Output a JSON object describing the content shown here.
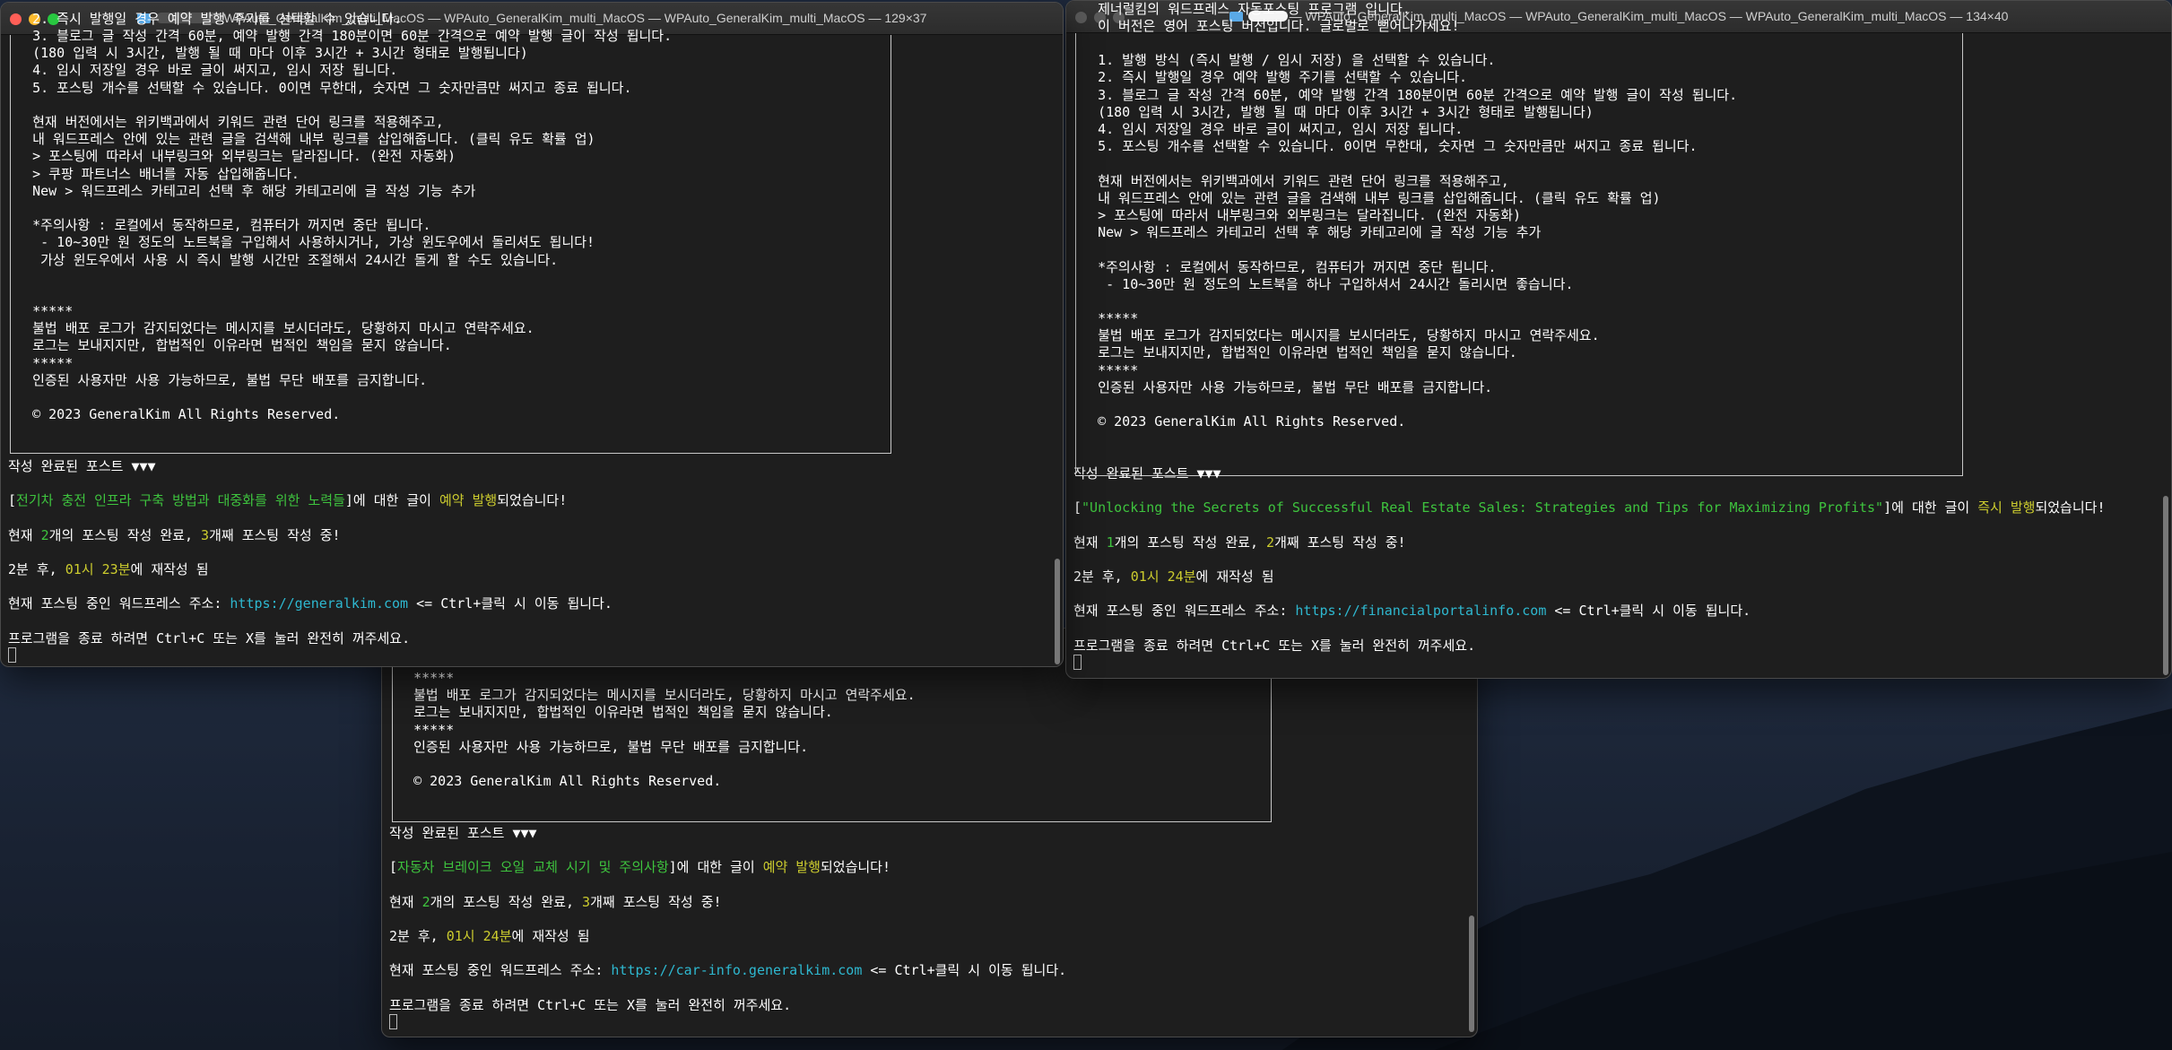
{
  "desktop": {
    "wallpaper": "night-mountain-wallpaper"
  },
  "windows": [
    {
      "id": "terminal-1",
      "title": "WPAuto_GeneralKim_multi_MacOS — WPAuto_GeneralKim_multi_MacOS — WPAuto_GeneralKim_multi_MacOS — 129×37",
      "lines": [
        "   2. 즉시 발행일 경우 예약 발행 주기를 선택할 수 있습니다.",
        "   3. 블로그 글 작성 간격 60분, 예약 발행 간격 180분이면 60분 간격으로 예약 발행 글이 작성 됩니다.",
        "   (180 입력 시 3시간, 발행 될 때 마다 이후 3시간 + 3시간 형태로 발행됩니다)",
        "   4. 임시 저장일 경우 바로 글이 써지고, 임시 저장 됩니다.",
        "   5. 포스팅 개수를 선택할 수 있습니다. 0이면 무한대, 숫자면 그 숫자만큼만 써지고 종료 됩니다.",
        "",
        "   현재 버전에서는 위키백과에서 키워드 관련 단어 링크를 적용해주고,",
        "   내 워드프레스 안에 있는 관련 글을 검색해 내부 링크를 삽입해줍니다. (클릭 유도 확률 업)",
        "   > 포스팅에 따라서 내부링크와 외부링크는 달라집니다. (완전 자동화)",
        "   > 쿠팡 파트너스 배너를 자동 삽입해줍니다.",
        "   New > 워드프레스 카테고리 선택 후 해당 카테고리에 글 작성 기능 추가",
        "",
        "   *주의사항 : 로컬에서 동작하므로, 컴퓨터가 꺼지면 중단 됩니다.",
        "    - 10~30만 원 정도의 노트북을 구입해서 사용하시거나, 가상 윈도우에서 돌리셔도 됩니다!",
        "    가상 윈도우에서 사용 시 즉시 발행 시간만 조절해서 24시간 돌게 할 수도 있습니다.",
        "",
        "",
        "   *****",
        "   불법 배포 로그가 감지되었다는 메시지를 보시더라도, 당황하지 마시고 연락주세요.",
        "   로그는 보내지지만, 합법적인 이유라면 법적인 책임을 묻지 않습니다.",
        "   *****",
        "   인증된 사용자만 사용 가능하므로, 불법 무단 배포를 금지합니다.",
        "",
        "   © 2023 GeneralKim All Rights Reserved.",
        "",
        "",
        "작성 완료된 포스트 ▼▼▼",
        "",
        "[전기차 충전 인프라 구축 방법과 대중화를 위한 노력들]에 대한 글이 예약 발행되었습니다!",
        "",
        "현재 2개의 포스팅 작성 완료, 3개째 포스팅 작성 중!",
        "",
        "2분 후, 01시 23분에 재작성 됨",
        "",
        "현재 포스팅 중인 워드프레스 주소: https://generalkim.com <= Ctrl+클릭 시 이동 됩니다.",
        "",
        "프로그램을 종료 하려면 Ctrl+C 또는 X를 눌러 완전히 꺼주세요."
      ]
    },
    {
      "id": "terminal-2",
      "title": "— WPAuto_GeneralKim_multi_MacOS — WPAuto_GeneralKim_multi_MacOS — WPAuto_GeneralKim_multi_MacOS — 134×40",
      "lines": [
        "",
        "   제너럴킴의 워드프레스 자동포스팅 프로그램 입니다.",
        "   이 버전은 영어 포스팅 버전입니다. 글로벌로 뻗어나가세요!",
        "",
        "   1. 발행 방식 (즉시 발행 / 임시 저장) 을 선택할 수 있습니다.",
        "   2. 즉시 발행일 경우 예약 발행 주기를 선택할 수 있습니다.",
        "   3. 블로그 글 작성 간격 60분, 예약 발행 간격 180분이면 60분 간격으로 예약 발행 글이 작성 됩니다.",
        "   (180 입력 시 3시간, 발행 될 때 마다 이후 3시간 + 3시간 형태로 발행됩니다)",
        "   4. 임시 저장일 경우 바로 글이 써지고, 임시 저장 됩니다.",
        "   5. 포스팅 개수를 선택할 수 있습니다. 0이면 무한대, 숫자면 그 숫자만큼만 써지고 종료 됩니다.",
        "",
        "   현재 버전에서는 위키백과에서 키워드 관련 단어 링크를 적용해주고,",
        "   내 워드프레스 안에 있는 관련 글을 검색해 내부 링크를 삽입해줍니다. (클릭 유도 확률 업)",
        "   > 포스팅에 따라서 내부링크와 외부링크는 달라집니다. (완전 자동화)",
        "   New > 워드프레스 카테고리 선택 후 해당 카테고리에 글 작성 기능 추가",
        "",
        "   *주의사항 : 로컬에서 동작하므로, 컴퓨터가 꺼지면 중단 됩니다.",
        "    - 10~30만 원 정도의 노트북을 하나 구입하셔서 24시간 돌리시면 좋습니다.",
        "",
        "   *****",
        "   불법 배포 로그가 감지되었다는 메시지를 보시더라도, 당황하지 마시고 연락주세요.",
        "   로그는 보내지지만, 합법적인 이유라면 법적인 책임을 묻지 않습니다.",
        "   *****",
        "   인증된 사용자만 사용 가능하므로, 불법 무단 배포를 금지합니다.",
        "",
        "   © 2023 GeneralKim All Rights Reserved.",
        "",
        "",
        "작성 완료된 포스트 ▼▼▼",
        "",
        "[\"Unlocking the Secrets of Successful Real Estate Sales: Strategies and Tips for Maximizing Profits\"]에 대한 글이 즉시 발행되었습니다!",
        "",
        "현재 1개의 포스팅 작성 완료, 2개째 포스팅 작성 중!",
        "",
        "2분 후, 01시 24분에 재작성 됨",
        "",
        "현재 포스팅 중인 워드프레스 주소: https://financialportalinfo.com <= Ctrl+클릭 시 이동 됩니다.",
        "",
        "프로그램을 종료 하려면 Ctrl+C 또는 X를 눌러 완전히 꺼주세요."
      ]
    },
    {
      "id": "terminal-3",
      "title": "",
      "lines": [
        "",
        "   *****",
        "   불법 배포 로그가 감지되었다는 메시지를 보시더라도, 당황하지 마시고 연락주세요.",
        "   로그는 보내지지만, 합법적인 이유라면 법적인 책임을 묻지 않습니다.",
        "   *****",
        "   인증된 사용자만 사용 가능하므로, 불법 무단 배포를 금지합니다.",
        "",
        "   © 2023 GeneralKim All Rights Reserved.",
        "",
        "",
        "작성 완료된 포스트 ▼▼▼",
        "",
        "[자동차 브레이크 오일 교체 시기 및 주의사항]에 대한 글이 예약 발행되었습니다!",
        "",
        "현재 2개의 포스팅 작성 완료, 3개째 포스팅 작성 중!",
        "",
        "2분 후, 01시 24분에 재작성 됨",
        "",
        "현재 포스팅 중인 워드프레스 주소: https://car-info.generalkim.com <= Ctrl+클릭 시 이동 됩니다.",
        "",
        "프로그램을 종료 하려면 Ctrl+C 또는 X를 눌러 완전히 꺼주세요."
      ]
    }
  ],
  "highlights": {
    "green": [
      "전기차 충전 인프라 구축 방법과 대중화를 위한 노력들",
      "\"Unlocking the Secrets of Successful Real Estate Sales: Strategies and Tips for Maximizing Profits\"",
      "자동차 브레이크 오일 교체 시기 및 주의사항",
      "2",
      "1"
    ],
    "yellow": [
      "예약 발행",
      "즉시 발행",
      "01시 23분",
      "01시 24분",
      "3",
      "2"
    ],
    "link": [
      "https://generalkim.com",
      "https://financialportalinfo.com",
      "https://car-info.generalkim.com"
    ]
  },
  "colors": {
    "terminal_bg": "#1e1e1e",
    "text": "#ffffff",
    "green": "#3ec43e",
    "yellow": "#cccc2e",
    "link": "#2eb8d0",
    "close": "#ff5f57",
    "minimize": "#febc2e",
    "zoom": "#28c840"
  }
}
